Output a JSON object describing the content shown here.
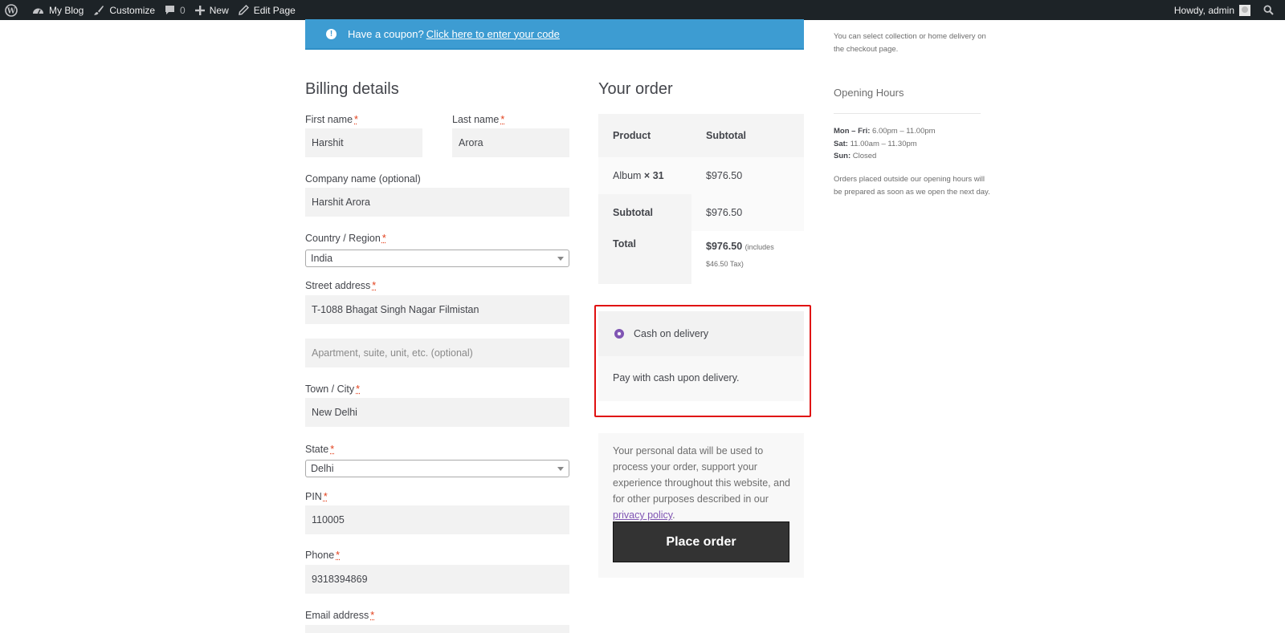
{
  "adminbar": {
    "site_name": "My Blog",
    "customize": "Customize",
    "comments_count": "0",
    "new": "New",
    "edit_page": "Edit Page",
    "howdy": "Howdy, admin"
  },
  "notice": {
    "text": "Have a coupon?",
    "link": "Click here to enter your code"
  },
  "billing": {
    "title": "Billing details",
    "first_name_label": "First name",
    "first_name_value": "Harshit",
    "last_name_label": "Last name",
    "last_name_value": "Arora",
    "company_label": "Company name (optional)",
    "company_value": "Harshit Arora",
    "country_label": "Country / Region",
    "country_value": "India",
    "street_label": "Street address",
    "street_value": "T-1088 Bhagat Singh Nagar Filmistan",
    "apartment_placeholder": "Apartment, suite, unit, etc. (optional)",
    "city_label": "Town / City",
    "city_value": "New Delhi",
    "state_label": "State",
    "state_value": "Delhi",
    "pin_label": "PIN",
    "pin_value": "110005",
    "phone_label": "Phone",
    "phone_value": "9318394869",
    "email_label": "Email address",
    "required_mark": "*"
  },
  "order": {
    "title": "Your order",
    "col_product": "Product",
    "col_subtotal": "Subtotal",
    "item_name": "Album",
    "item_qty": "× 31",
    "item_price": "$976.50",
    "subtotal_label": "Subtotal",
    "subtotal_value": "$976.50",
    "total_label": "Total",
    "total_value": "$976.50",
    "total_tax_line1": "(includes",
    "total_tax_line2": "$46.50 Tax)"
  },
  "payment": {
    "method": "Cash on delivery",
    "description": "Pay with cash upon delivery."
  },
  "privacy": {
    "text": "Your personal data will be used to process your order, support your experience throughout this website, and for other purposes described in our",
    "link": "privacy policy",
    "period": ".",
    "button": "Place order"
  },
  "sidebar": {
    "delivery_line1": "You can select collection or home delivery on",
    "delivery_line2": "the checkout page.",
    "hours_title": "Opening Hours",
    "mon_fri_label": "Mon – Fri:",
    "mon_fri_value": "6.00pm – 11.00pm",
    "sat_label": "Sat:",
    "sat_value": "11.00am – 11.30pm",
    "sun_label": "Sun:",
    "sun_value": "Closed",
    "note_line1": "Orders placed outside our opening hours will",
    "note_line2": "be prepared as soon as we open the next day."
  },
  "colors": {
    "adminbar": "#1d2327",
    "notice": "#3d9cd2",
    "accent": "#7f54b3",
    "button": "#333333",
    "highlight": "#e01010"
  }
}
